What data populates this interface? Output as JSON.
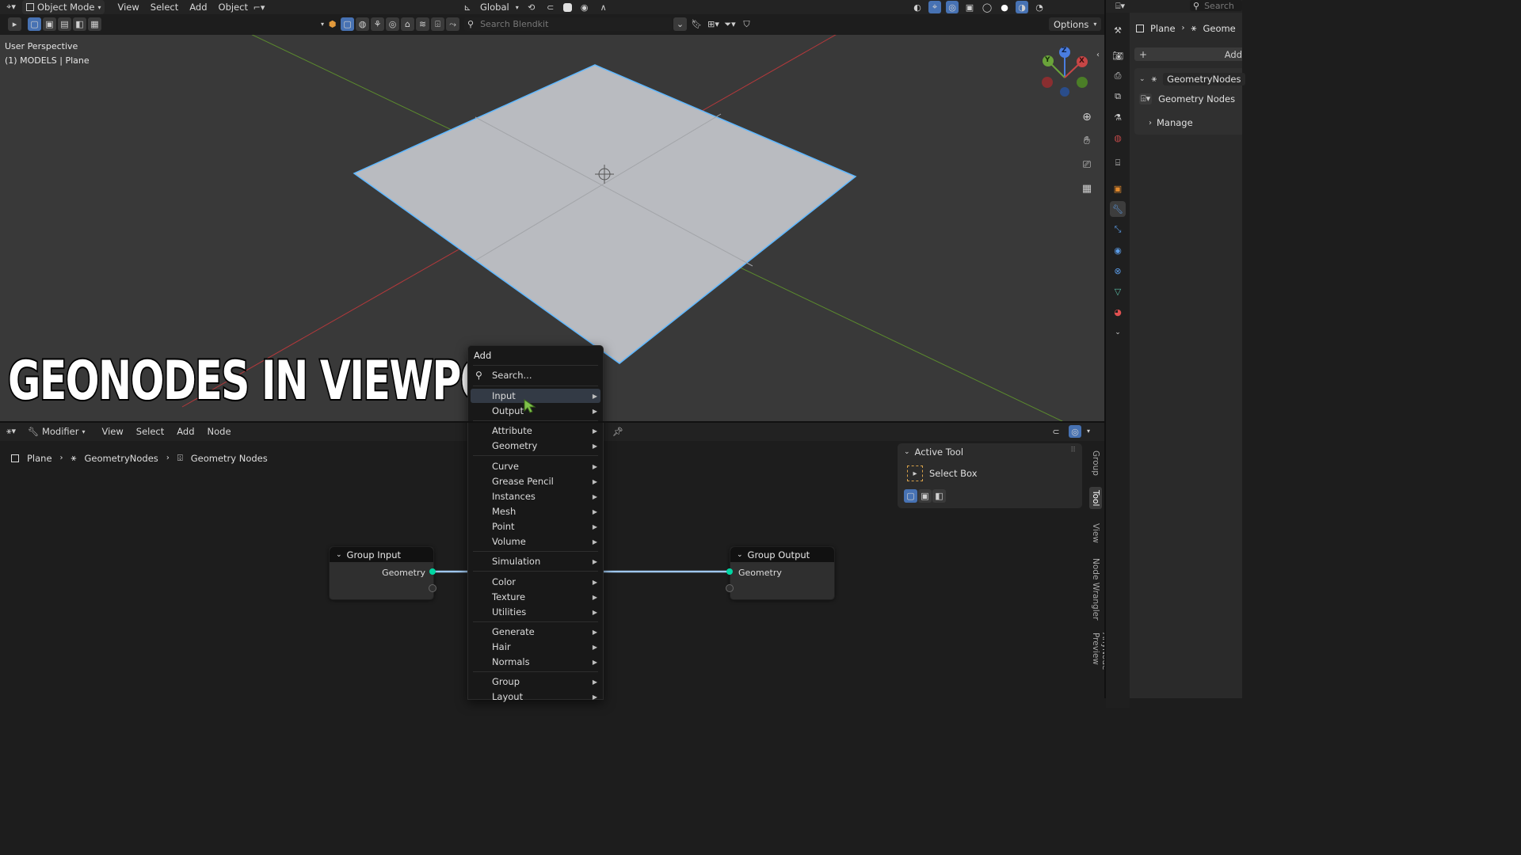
{
  "viewport_header": {
    "mode": "Object Mode",
    "menus": [
      "View",
      "Select",
      "Add",
      "Object"
    ],
    "transform_orientation": "Global",
    "search_placeholder": "Search Blendkit",
    "options_label": "Options"
  },
  "viewport": {
    "overlay_title": "User Perspective",
    "overlay_subtitle": "(1) MODELS | Plane",
    "gizmo": {
      "x": "X",
      "y": "Y",
      "z": "Z"
    }
  },
  "caption": "GEONODES IN VIEWPORT",
  "node_editor_header": {
    "editor_type": "Modifier",
    "menus": [
      "View",
      "Select",
      "Add",
      "Node"
    ]
  },
  "breadcrumb": {
    "object": "Plane",
    "modifier": "GeometryNodes",
    "node_group": "Geometry Nodes"
  },
  "nodes": {
    "group_input": {
      "title": "Group Input",
      "socket": "Geometry"
    },
    "group_output": {
      "title": "Group Output",
      "socket": "Geometry"
    }
  },
  "active_tool": {
    "header": "Active Tool",
    "tool_name": "Select Box"
  },
  "sidebar_tabs": [
    "Group",
    "Tool",
    "View",
    "Node Wrangler",
    "AnyNode Preview"
  ],
  "add_menu": {
    "title": "Add",
    "search": "Search...",
    "items": [
      "Input",
      "Output",
      "Attribute",
      "Geometry",
      "Curve",
      "Grease Pencil",
      "Instances",
      "Mesh",
      "Point",
      "Volume",
      "Simulation",
      "Color",
      "Texture",
      "Utilities",
      "Generate",
      "Hair",
      "Normals",
      "Group",
      "Layout"
    ],
    "highlighted": "Input"
  },
  "properties": {
    "search_placeholder": "Search",
    "breadcrumb_object": "Plane",
    "breadcrumb_modifier": "Geome",
    "add_modifier_label": "Add",
    "modifier_name": "GeometryNodes",
    "node_group": "Geometry Nodes",
    "manage_label": "Manage"
  },
  "colors": {
    "accent": "#4772b3",
    "socket_geometry": "#00d6a3",
    "plane_fill": "#b9bbc0",
    "plane_outline": "#5fb8ff",
    "axis_x": "#b3393b",
    "axis_y": "#5b8a2e"
  }
}
